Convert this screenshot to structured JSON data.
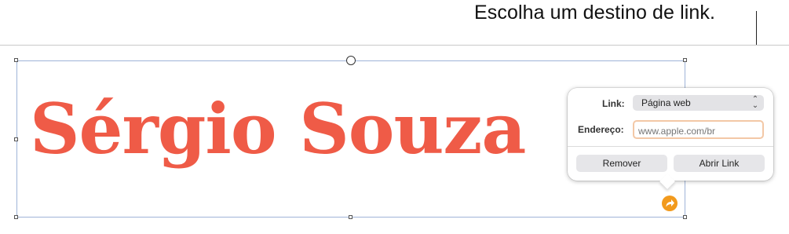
{
  "callout": {
    "text": "Escolha um destino de link."
  },
  "canvas": {
    "text": "Sérgio Souza"
  },
  "link_popover": {
    "link_label": "Link:",
    "link_type": "Página web",
    "address_label": "Endereço:",
    "address_placeholder": "www.apple.com/br",
    "remove_button": "Remover",
    "open_button": "Abrir Link"
  },
  "colors": {
    "text_accent": "#ef5b47",
    "link_badge": "#f29a1d",
    "focus_ring": "#f3c8a6"
  },
  "icons": {
    "select_chevron": "chevron-up-down-icon",
    "link_badge": "link-arrow-icon"
  }
}
